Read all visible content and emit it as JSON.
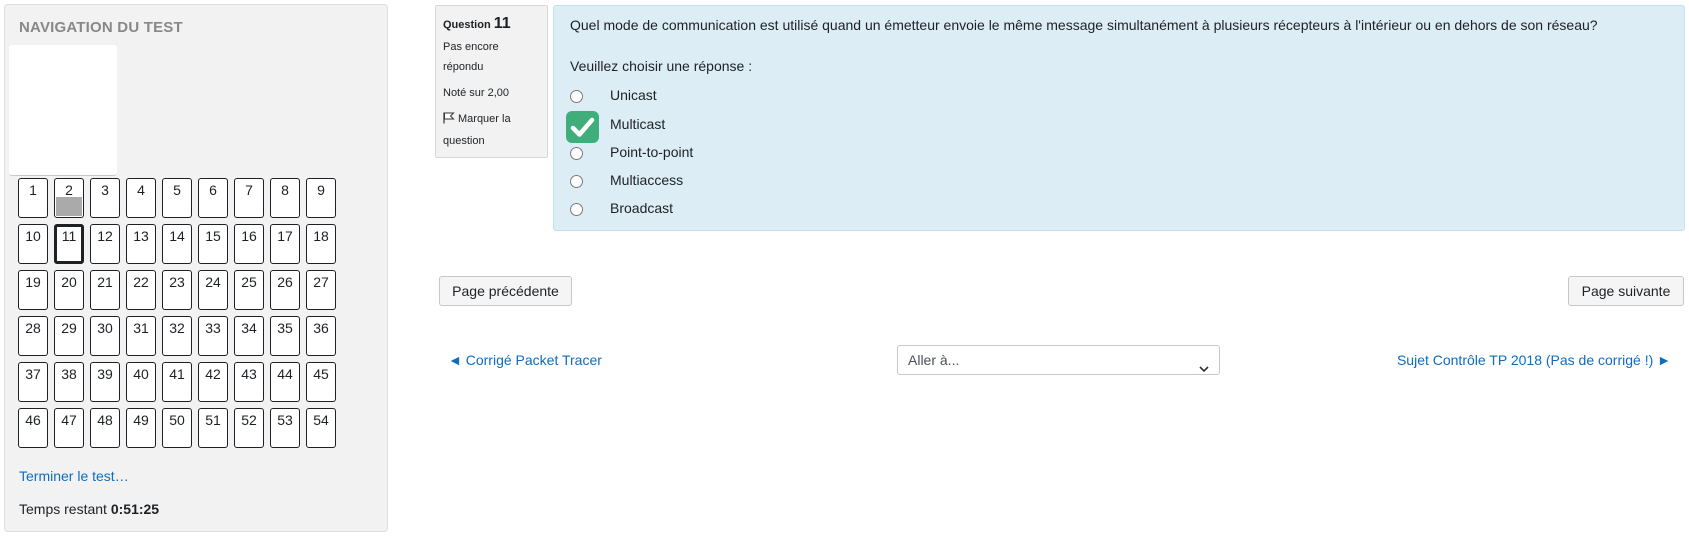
{
  "nav": {
    "title": "NAVIGATION DU TEST",
    "questions": [
      {
        "n": "1"
      },
      {
        "n": "2",
        "answered": true
      },
      {
        "n": "3"
      },
      {
        "n": "4"
      },
      {
        "n": "5"
      },
      {
        "n": "6"
      },
      {
        "n": "7"
      },
      {
        "n": "8"
      },
      {
        "n": "9"
      },
      {
        "n": "10"
      },
      {
        "n": "11",
        "current": true
      },
      {
        "n": "12"
      },
      {
        "n": "13"
      },
      {
        "n": "14"
      },
      {
        "n": "15"
      },
      {
        "n": "16"
      },
      {
        "n": "17"
      },
      {
        "n": "18"
      },
      {
        "n": "19"
      },
      {
        "n": "20"
      },
      {
        "n": "21"
      },
      {
        "n": "22"
      },
      {
        "n": "23"
      },
      {
        "n": "24"
      },
      {
        "n": "25"
      },
      {
        "n": "26"
      },
      {
        "n": "27"
      },
      {
        "n": "28"
      },
      {
        "n": "29"
      },
      {
        "n": "30"
      },
      {
        "n": "31"
      },
      {
        "n": "32"
      },
      {
        "n": "33"
      },
      {
        "n": "34"
      },
      {
        "n": "35"
      },
      {
        "n": "36"
      },
      {
        "n": "37"
      },
      {
        "n": "38"
      },
      {
        "n": "39"
      },
      {
        "n": "40"
      },
      {
        "n": "41"
      },
      {
        "n": "42"
      },
      {
        "n": "43"
      },
      {
        "n": "44"
      },
      {
        "n": "45"
      },
      {
        "n": "46"
      },
      {
        "n": "47"
      },
      {
        "n": "48"
      },
      {
        "n": "49"
      },
      {
        "n": "50"
      },
      {
        "n": "51"
      },
      {
        "n": "52"
      },
      {
        "n": "53"
      },
      {
        "n": "54"
      }
    ],
    "finish_label": "Terminer le test…",
    "time_label": "Temps restant",
    "time_value": "0:51:25"
  },
  "question_info": {
    "label": "Question",
    "number": "11",
    "state": "Pas encore répondu",
    "grade": "Noté sur 2,00",
    "flag_label": "Marquer la question"
  },
  "question": {
    "text": "Quel mode de communication est utilisé quand un émetteur envoie le même message simultanément à plusieurs récepteurs à l'intérieur ou en dehors de son réseau?",
    "prompt": "Veuillez choisir une réponse :",
    "answers": [
      "Unicast",
      "Multicast",
      "Point-to-point",
      "Multiaccess",
      "Broadcast"
    ],
    "checked_overlay_on": "Multicast",
    "check_color": "#3fae7a"
  },
  "buttons": {
    "prev": "Page précédente",
    "next": "Page suivante"
  },
  "activity_nav": {
    "prev_link": "◄ Corrigé Packet Tracer",
    "jump_placeholder": "Aller à...",
    "next_link": "Sujet Contrôle TP 2018 (Pas de corrigé !) ►"
  },
  "colors": {
    "link": "#0f6cbf",
    "question_bg": "#dcedf6",
    "nav_bg": "#f2f2f2",
    "answered_fill": "#aaaaaa"
  }
}
